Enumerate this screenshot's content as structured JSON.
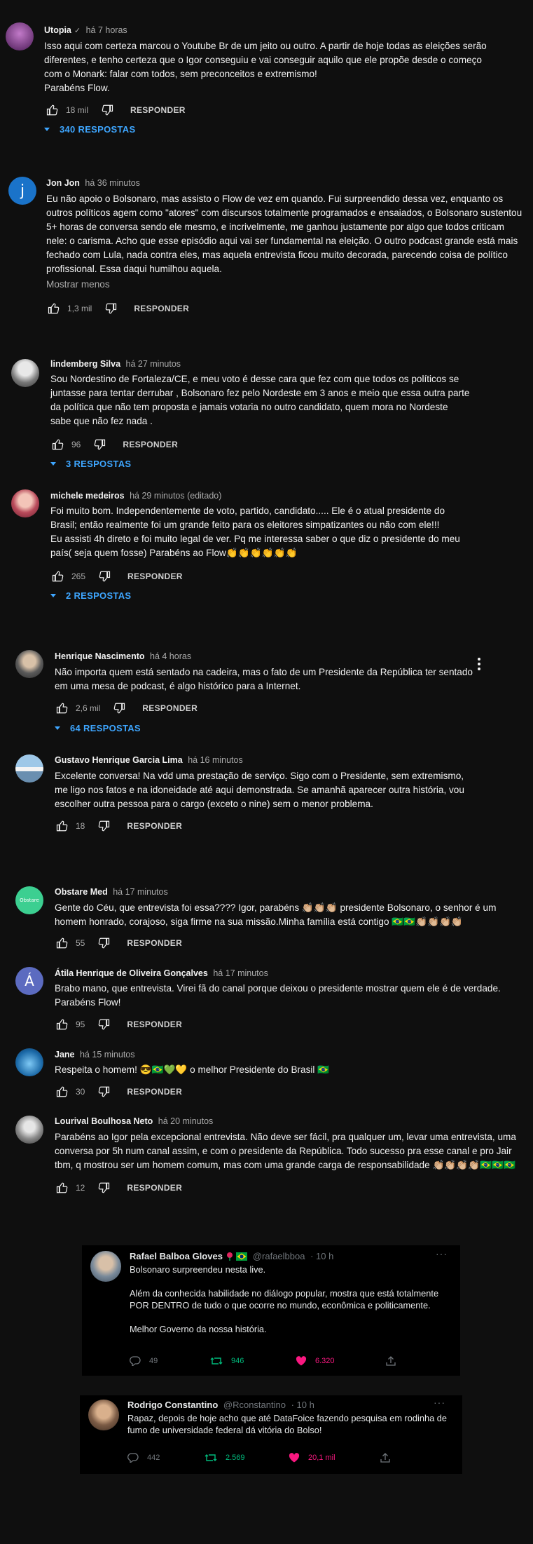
{
  "colors": {
    "background": "#0f0f0f",
    "text": "#f1f1f1",
    "secondary": "#aaaaaa",
    "link": "#3ea6ff",
    "retweet": "#00ba7c",
    "like": "#f91880"
  },
  "labels": {
    "reply": "RESPONDER",
    "show_less": "Mostrar menos"
  },
  "comments": [
    {
      "author": "Utopia",
      "verified_icon": "check-icon",
      "time": "há 7 horas",
      "text": "Isso aqui com certeza marcou o Youtube Br de um jeito ou outro. A partir de hoje todas as eleições serão diferentes, e tenho certeza que o Igor conseguiu e vai conseguir aquilo que ele propõe desde o começo com o Monark: falar com todos, sem preconceitos e extremismo!\nParabéns Flow.",
      "likes": "18 mil",
      "replies": "340 RESPOSTAS"
    },
    {
      "author": "Jon Jon",
      "time": "há 36 minutos",
      "avatar_letter": "j",
      "text": "Eu não apoio o Bolsonaro, mas assisto o Flow de vez em quando. Fui surpreendido dessa vez, enquanto os outros políticos agem como \"atores\" com discursos totalmente programados e ensaiados, o Bolsonaro sustentou 5+ horas de conversa sendo ele mesmo, e incrivelmente, me ganhou justamente por algo que todos criticam nele: o carisma. Acho que esse episódio aqui vai ser fundamental na eleição. O outro podcast grande está mais fechado com Lula, nada contra eles, mas aquela entrevista ficou muito decorada, parecendo coisa de político profissional. Essa daqui humilhou aquela.",
      "likes": "1,3 mil"
    },
    {
      "author": "lindemberg Silva",
      "time": "há 27 minutos",
      "text": "Sou Nordestino de Fortaleza/CE, e meu voto é desse cara que fez com que todos os políticos se juntasse para tentar derrubar , Bolsonaro fez pelo Nordeste em 3 anos e meio que essa outra parte da política que não tem proposta e jamais votaria no outro candidato, quem mora no Nordeste sabe que não fez nada .",
      "likes": "96",
      "replies": "3 RESPOSTAS"
    },
    {
      "author": "michele medeiros",
      "time": "há 29 minutos (editado)",
      "text": "Foi muito bom. Independentemente de voto, partido, candidato..... Ele é o atual presidente do Brasil; então realmente foi um grande feito para os eleitores simpatizantes ou não com ele!!!\nEu assisti 4h direto e foi muito legal de ver. Pq me interessa saber o que diz o presidente do meu país( seja quem fosse) Parabéns ao Flow👏👏👏👏👏👏",
      "likes": "265",
      "replies": "2 RESPOSTAS"
    },
    {
      "author": "Henrique Nascimento",
      "time": "há 4 horas",
      "text": "Não importa quem está sentado na cadeira, mas o fato de um Presidente da República ter sentado em uma mesa de podcast, é algo histórico para a Internet.",
      "likes": "2,6 mil",
      "replies": "64 RESPOSTAS"
    },
    {
      "author": "Gustavo Henrique Garcia Lima",
      "time": "há 16 minutos",
      "text": "Excelente conversa! Na vdd uma prestação de serviço. Sigo com o Presidente, sem extremismo, me ligo nos fatos e na idoneidade até aqui demonstrada. Se amanhã aparecer outra história, vou escolher outra pessoa para o cargo (exceto o nine) sem o menor problema.",
      "likes": "18"
    },
    {
      "author": "Obstare Med",
      "time": "há 17 minutos",
      "avatar_text": "Obstare",
      "text": "Gente do Céu, que entrevista foi essa???? Igor, parabéns 👏🏼👏🏼👏🏼 presidente Bolsonaro, o senhor é um homem honrado, corajoso, siga firme na sua missão.Minha família está contigo 🇧🇷🇧🇷👏🏼👏🏼👏🏼👏🏼",
      "likes": "55"
    },
    {
      "author": "Átila Henrique de Oliveira Gonçalves",
      "time": "há 17 minutos",
      "avatar_letter": "Á",
      "text": "Brabo mano, que entrevista. Virei fã do canal porque deixou o presidente mostrar quem ele é de verdade.\nParabéns Flow!",
      "likes": "95"
    },
    {
      "author": "Jane",
      "time": "há 15 minutos",
      "text": "Respeita o homem! 😎🇧🇷💚💛 o melhor Presidente do Brasil 🇧🇷",
      "likes": "30"
    },
    {
      "author": "Lourival Boulhosa Neto",
      "time": "há 20 minutos",
      "text": "Parabéns ao Igor pela excepcional entrevista. Não deve ser fácil, pra qualquer um, levar uma entrevista, uma conversa por 5h num canal assim, e com o presidente da República. Todo sucesso pra esse canal e pro Jair tbm, q mostrou ser um homem comum, mas com uma grande carga de responsabilidade 👏🏼👏🏼👏🏼👏🏼🇧🇷🇧🇷🇧🇷",
      "likes": "12"
    }
  ],
  "tweets": [
    {
      "name": "Rafael Balboa Gloves",
      "handle": "@rafaelbboa",
      "time": "· 10 h",
      "text": "Bolsonaro surpreendeu nesta live.\n\nAlém da conhecida habilidade no diálogo popular, mostra que está totalmente POR DENTRO de tudo o que ocorre no mundo, econômica e politicamente.\n\nMelhor Governo da nossa história.",
      "replies": "49",
      "retweets": "946",
      "likes": "6.320"
    },
    {
      "name": "Rodrigo Constantino",
      "handle": "@Rconstantino",
      "time": "· 10 h",
      "text": "Rapaz, depois de hoje acho que até DataFoice fazendo pesquisa em rodinha de fumo de universidade federal dá vitória do Bolso!",
      "replies": "442",
      "retweets": "2.569",
      "likes": "20,1 mil"
    }
  ]
}
